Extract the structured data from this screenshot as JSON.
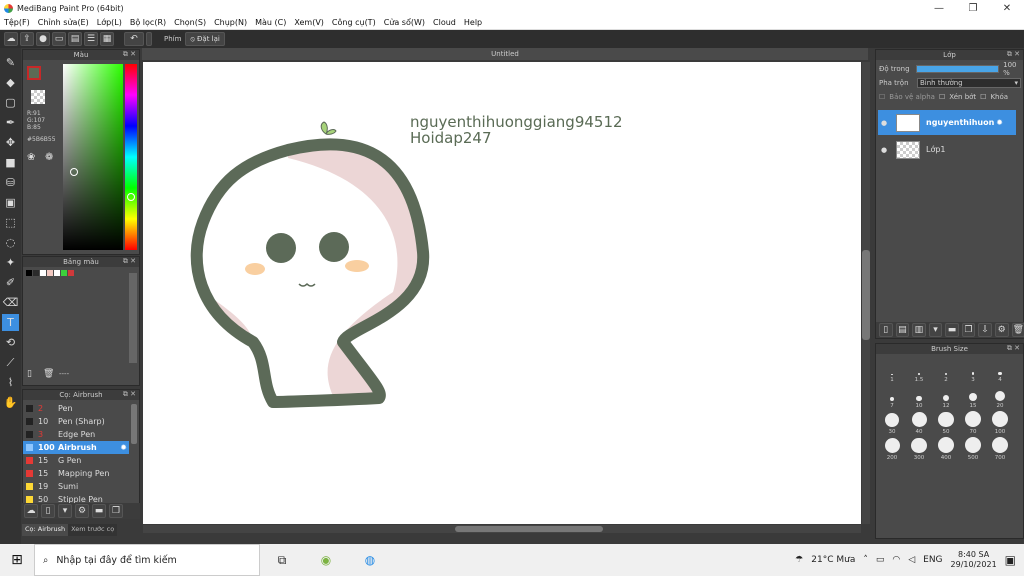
{
  "window": {
    "title": "MediBang Paint Pro (64bit)",
    "minimize": "—",
    "maximize": "❐",
    "close": "✕"
  },
  "menu": [
    "Tệp(F)",
    "Chỉnh sửa(E)",
    "Lớp(L)",
    "Bộ lọc(R)",
    "Chọn(S)",
    "Chụp(N)",
    "Màu (C)",
    "Xem(V)",
    "Công cụ(T)",
    "Cửa sổ(W)",
    "Cloud",
    "Help"
  ],
  "toolbar": {
    "keys_label": "Phím",
    "reset_label": "Đặt lại"
  },
  "color_panel": {
    "title": "Màu",
    "r": "R:91",
    "g": "G:107",
    "b": "B:85",
    "hex": "#5B6B55",
    "fg_color": "#5b6b55"
  },
  "palette_panel": {
    "title": "Bảng màu",
    "swatches": [
      "#000000",
      "#2b2b2b",
      "#ffffff",
      "#f1c8c0",
      "#ffffff",
      "#3ccf3c",
      "#d0393b"
    ],
    "footer_text": "----"
  },
  "brush_panel": {
    "title": "Cọ: Airbrush",
    "items": [
      {
        "size": "2",
        "name": "Pen",
        "color": "#222222",
        "size_color": "#e53935"
      },
      {
        "size": "10",
        "name": "Pen (Sharp)",
        "color": "#222222",
        "size_color": "#ddd"
      },
      {
        "size": "3",
        "name": "Edge Pen",
        "color": "#222222",
        "size_color": "#e53935"
      },
      {
        "size": "100",
        "name": "Airbrush",
        "color": "#8ec7ff",
        "size_color": "#fff",
        "selected": true
      },
      {
        "size": "15",
        "name": "G Pen",
        "color": "#e53935",
        "size_color": "#ddd"
      },
      {
        "size": "15",
        "name": "Mapping Pen",
        "color": "#e53935",
        "size_color": "#ddd"
      },
      {
        "size": "19",
        "name": "Sumi",
        "color": "#fdd835",
        "size_color": "#ddd"
      },
      {
        "size": "50",
        "name": "Stipple Pen",
        "color": "#fdd835",
        "size_color": "#ddd"
      }
    ],
    "tabs": [
      "Cọ: Airbrush",
      "Xem trước cọ"
    ]
  },
  "canvas": {
    "title": "Untitled",
    "text_line1": "nguyenthihuonggiang94512",
    "text_line2": "Hoidap247"
  },
  "layer_panel": {
    "title": "Lớp",
    "opacity_label": "Độ trong",
    "opacity_value": "100 %",
    "opacity_fraction": 1.0,
    "blend_label": "Pha trộn",
    "blend_value": "Bình thường",
    "protect_alpha": "Bảo vệ alpha",
    "clipping": "Xén bớt",
    "lock": "Khóa",
    "layers": [
      {
        "name": "nguyenthihuon",
        "selected": true
      },
      {
        "name": "Lớp1",
        "selected": false
      }
    ]
  },
  "brush_size_panel": {
    "title": "Brush Size",
    "sizes": [
      "1",
      "1.5",
      "2",
      "3",
      "4",
      "7",
      "10",
      "12",
      "15",
      "20",
      "30",
      "40",
      "50",
      "70",
      "100",
      "200",
      "300",
      "400",
      "500",
      "700"
    ]
  },
  "taskbar": {
    "search_placeholder": "Nhập tại đây để tìm kiếm",
    "weather": "21°C  Mưa",
    "language": "ENG",
    "time": "8:40 SA",
    "date": "29/10/2021"
  }
}
